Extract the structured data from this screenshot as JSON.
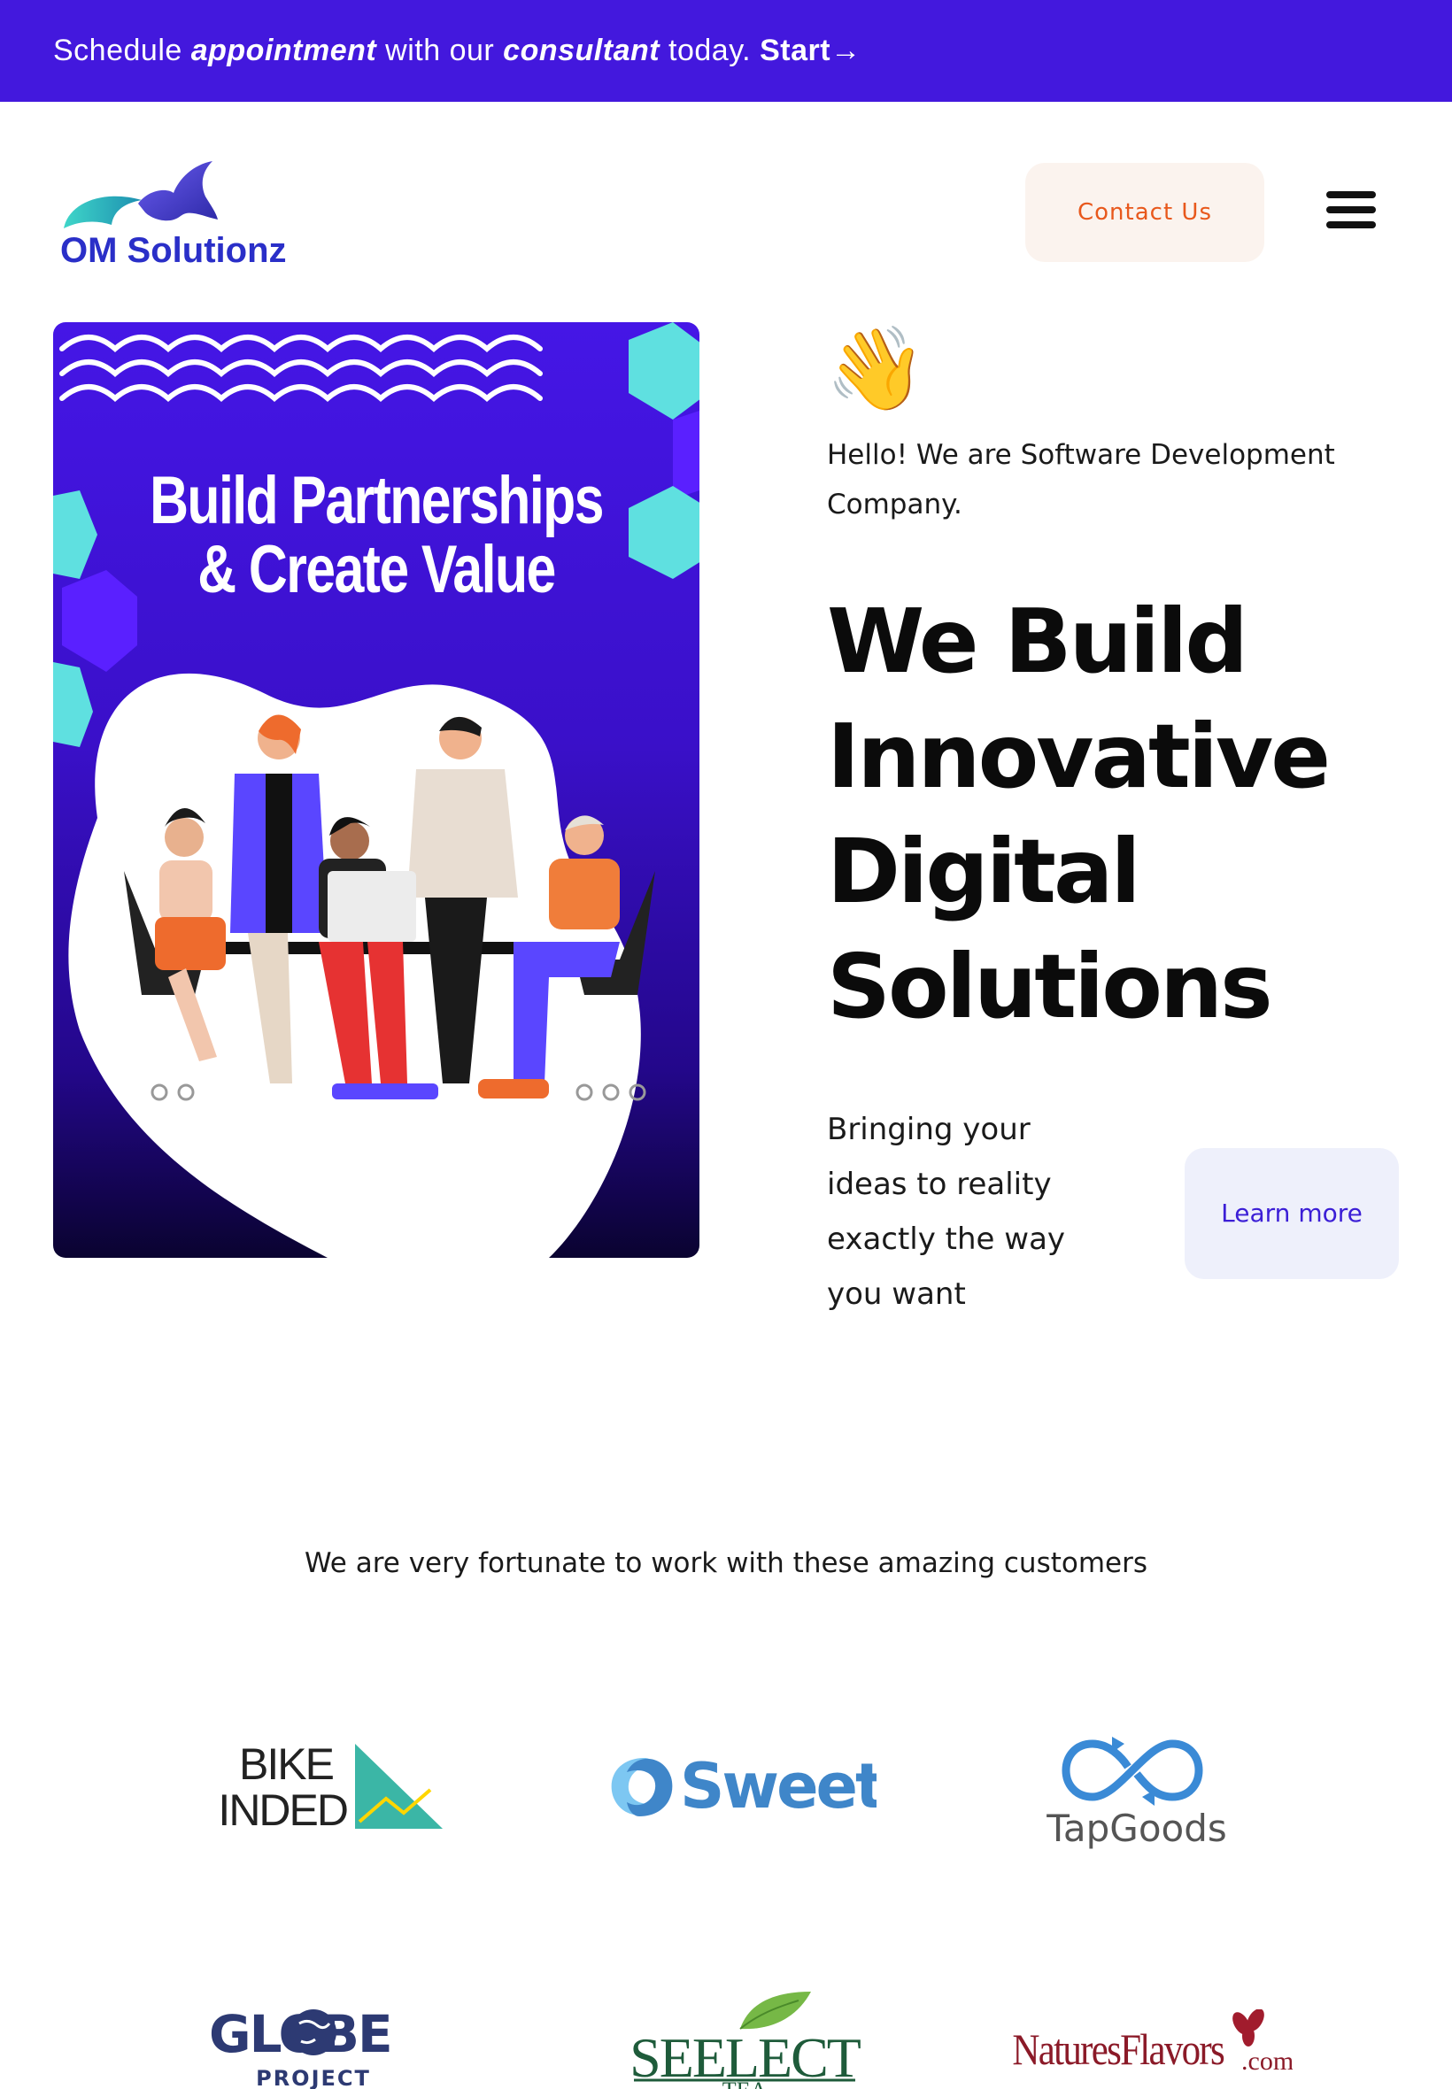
{
  "announcement": {
    "part1": "Schedule ",
    "em1": "appointment",
    "part2": " with our ",
    "em2": "consultant",
    "part3": " today.",
    "cta": "Start→"
  },
  "header": {
    "logo_text": "OM Solutionz",
    "contact_label": "Contact Us",
    "menu_icon": "hamburger-menu-icon"
  },
  "hero": {
    "image_title_line1": "Build Partnerships",
    "image_title_line2": "& Create Value",
    "wave_emoji": "👋",
    "intro": "Hello! We are Software Development Company.",
    "headline": "We Build Innovative Digital Solutions",
    "tagline": "Bringing your ideas to reality exactly the way you want",
    "learn_more_label": "Learn more"
  },
  "customers": {
    "title": "We are very fortunate to work with these amazing customers",
    "logos": [
      {
        "line1": "BIKE",
        "line2": "MINDED"
      },
      {
        "name": "Sweet"
      },
      {
        "name": "TapGoods"
      },
      {
        "name": "GLOBE",
        "sub": "PROJECT"
      },
      {
        "name": "SEELECT",
        "sub": "TEA"
      },
      {
        "name": "NaturesFlavors",
        "suffix": ".com"
      }
    ]
  },
  "colors": {
    "brand_purple": "#4318dd",
    "contact_orange": "#e8581c",
    "accent_cyan": "#5fe0e0"
  }
}
